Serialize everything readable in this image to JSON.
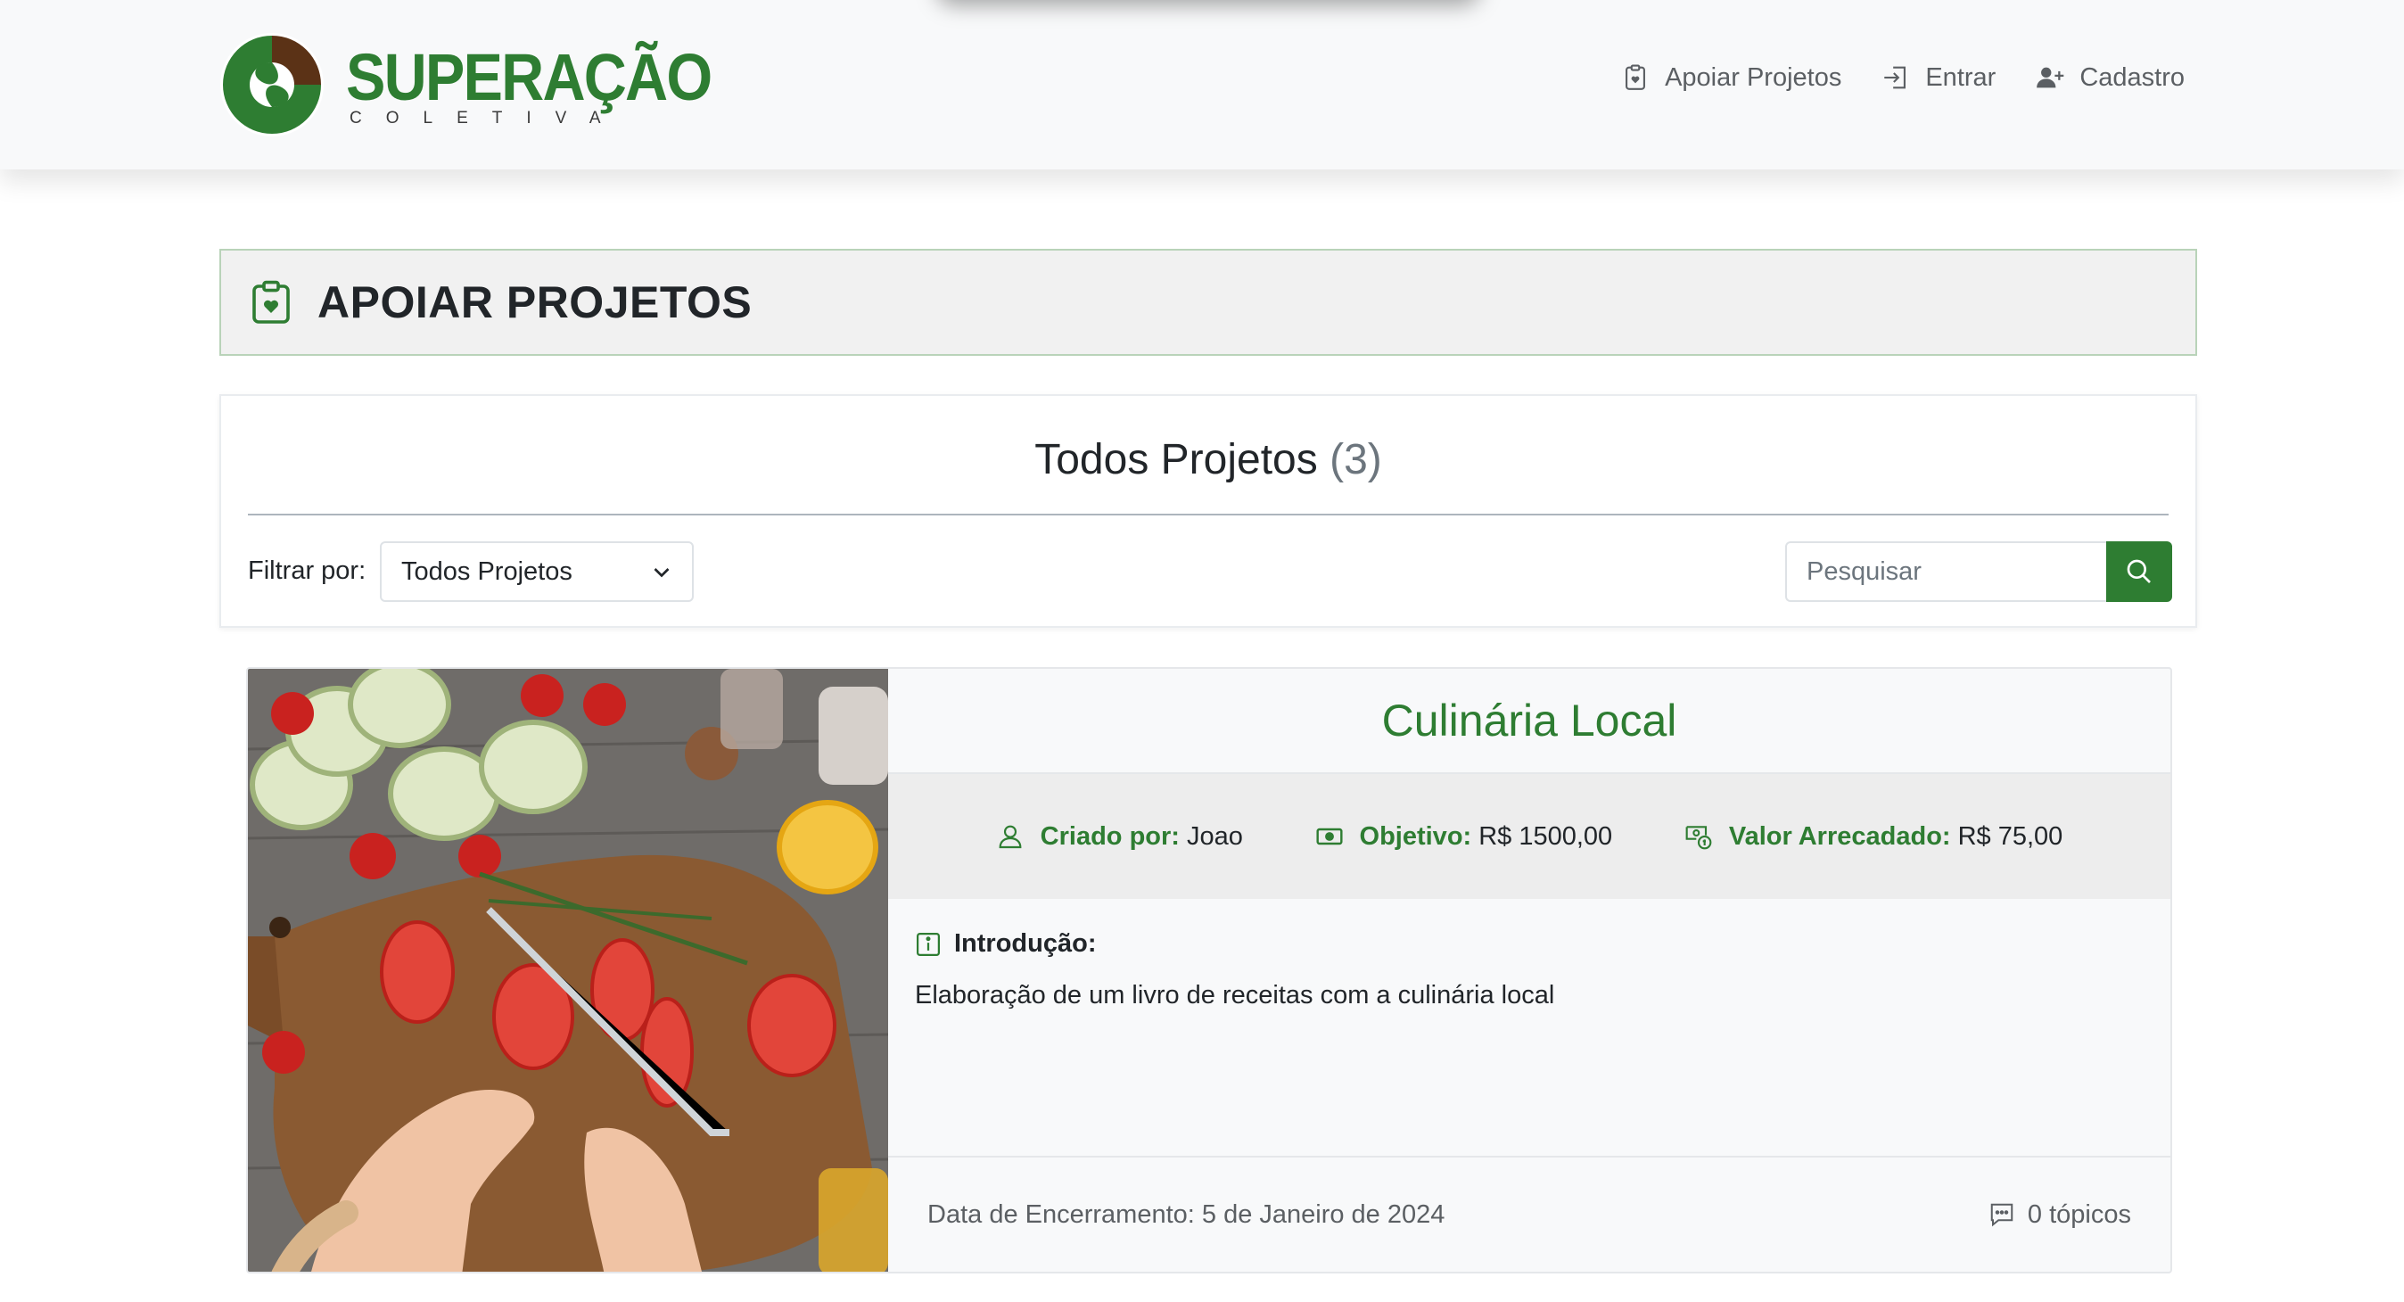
{
  "brand": {
    "name": "SUPERAÇÃO",
    "subtitle": "COLETIVA",
    "colors": {
      "green": "#2e7d32",
      "brown": "#5b3216"
    }
  },
  "nav": {
    "links": [
      {
        "label": "Apoiar Projetos",
        "icon": "clipboard-heart-icon"
      },
      {
        "label": "Entrar",
        "icon": "login-icon"
      },
      {
        "label": "Cadastro",
        "icon": "person-plus-icon"
      }
    ]
  },
  "page": {
    "title": "APOIAR PROJETOS",
    "icon": "clipboard-heart-icon"
  },
  "filter": {
    "heading": "Todos Projetos",
    "count": "(3)",
    "label": "Filtrar por:",
    "selected": "Todos Projetos",
    "search_placeholder": "Pesquisar",
    "search_icon": "search-icon"
  },
  "project": {
    "title": "Culinária Local",
    "image_alt": "cutting board with sliced tomatoes, zucchini and spices",
    "created_by_label": "Criado por:",
    "created_by": "Joao",
    "goal_label": "Objetivo:",
    "goal": "R$ 1500,00",
    "raised_label": "Valor Arrecadado:",
    "raised": "R$ 75,00",
    "intro_label": "Introdução:",
    "intro": "Elaboração de um livro de receitas com a culinária local",
    "closing": "Data de Encerramento: 5 de Janeiro de 2024",
    "topics": "0 tópicos"
  }
}
